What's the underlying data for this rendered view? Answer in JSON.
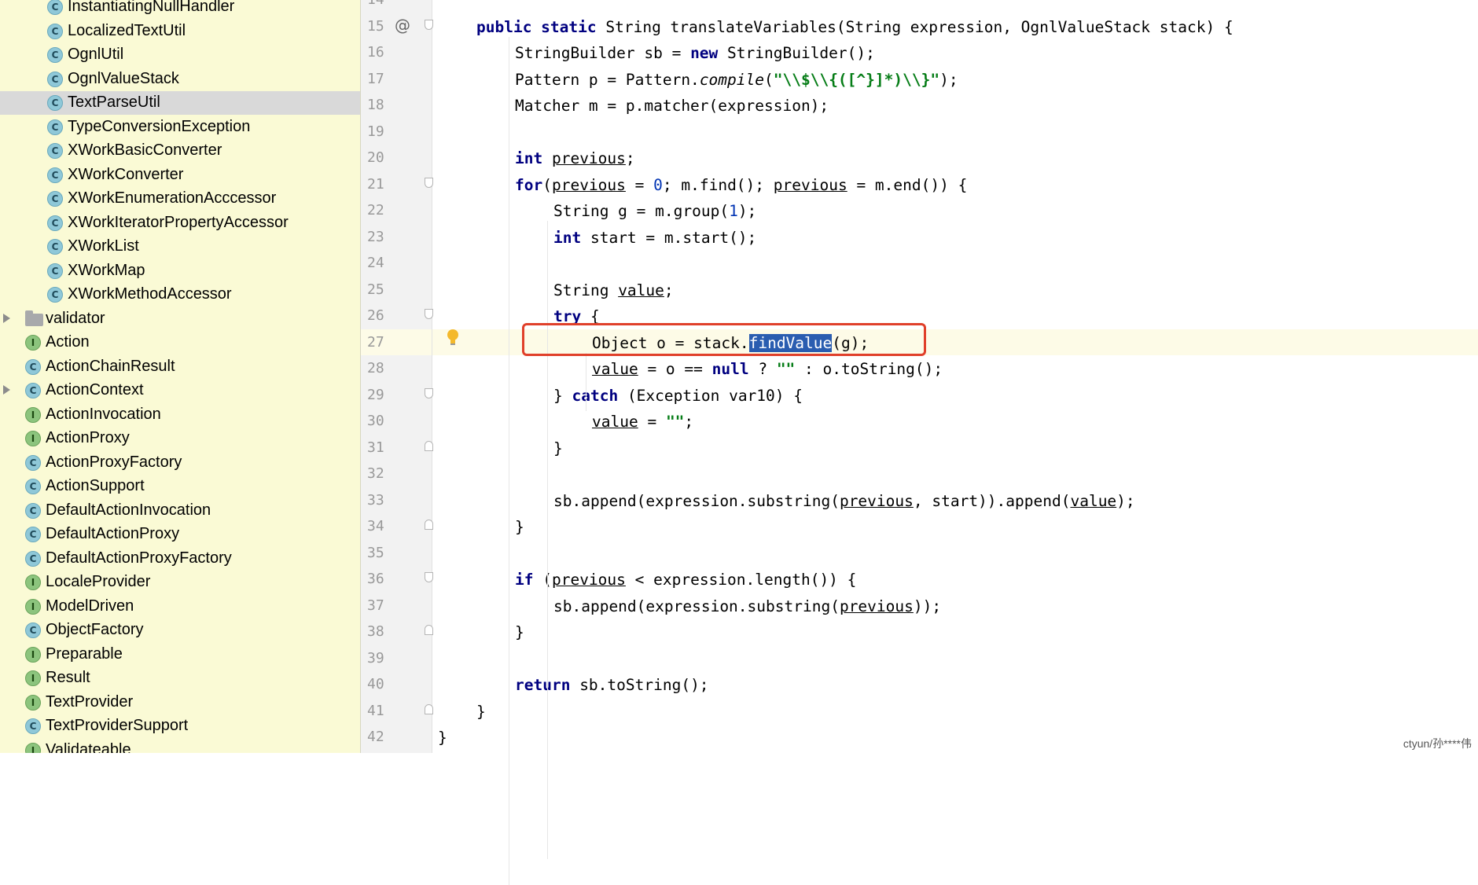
{
  "sidebar": {
    "items": [
      {
        "label": "InstantiatingNullHandler",
        "type": "class",
        "indent": 1,
        "selected": false,
        "expandable": false
      },
      {
        "label": "LocalizedTextUtil",
        "type": "class",
        "indent": 1,
        "selected": false,
        "expandable": false
      },
      {
        "label": "OgnlUtil",
        "type": "class",
        "indent": 1,
        "selected": false,
        "expandable": false
      },
      {
        "label": "OgnlValueStack",
        "type": "class",
        "indent": 1,
        "selected": false,
        "expandable": false
      },
      {
        "label": "TextParseUtil",
        "type": "class",
        "indent": 1,
        "selected": true,
        "expandable": false
      },
      {
        "label": "TypeConversionException",
        "type": "class",
        "indent": 1,
        "selected": false,
        "expandable": false
      },
      {
        "label": "XWorkBasicConverter",
        "type": "class",
        "indent": 1,
        "selected": false,
        "expandable": false
      },
      {
        "label": "XWorkConverter",
        "type": "class",
        "indent": 1,
        "selected": false,
        "expandable": false
      },
      {
        "label": "XWorkEnumerationAcccessor",
        "type": "class",
        "indent": 1,
        "selected": false,
        "expandable": false
      },
      {
        "label": "XWorkIteratorPropertyAccessor",
        "type": "class",
        "indent": 1,
        "selected": false,
        "expandable": false
      },
      {
        "label": "XWorkList",
        "type": "class",
        "indent": 1,
        "selected": false,
        "expandable": false
      },
      {
        "label": "XWorkMap",
        "type": "class",
        "indent": 1,
        "selected": false,
        "expandable": false
      },
      {
        "label": "XWorkMethodAccessor",
        "type": "class",
        "indent": 1,
        "selected": false,
        "expandable": false
      },
      {
        "label": "validator",
        "type": "folder",
        "indent": 0,
        "selected": false,
        "expandable": true
      },
      {
        "label": "Action",
        "type": "interface",
        "indent": 0,
        "selected": false,
        "expandable": false
      },
      {
        "label": "ActionChainResult",
        "type": "class",
        "indent": 0,
        "selected": false,
        "expandable": false
      },
      {
        "label": "ActionContext",
        "type": "class",
        "indent": 0,
        "selected": false,
        "expandable": true
      },
      {
        "label": "ActionInvocation",
        "type": "interface",
        "indent": 0,
        "selected": false,
        "expandable": false
      },
      {
        "label": "ActionProxy",
        "type": "interface",
        "indent": 0,
        "selected": false,
        "expandable": false
      },
      {
        "label": "ActionProxyFactory",
        "type": "class",
        "indent": 0,
        "selected": false,
        "expandable": false
      },
      {
        "label": "ActionSupport",
        "type": "class",
        "indent": 0,
        "selected": false,
        "expandable": false
      },
      {
        "label": "DefaultActionInvocation",
        "type": "class",
        "indent": 0,
        "selected": false,
        "expandable": false
      },
      {
        "label": "DefaultActionProxy",
        "type": "class",
        "indent": 0,
        "selected": false,
        "expandable": false
      },
      {
        "label": "DefaultActionProxyFactory",
        "type": "class",
        "indent": 0,
        "selected": false,
        "expandable": false
      },
      {
        "label": "LocaleProvider",
        "type": "interface",
        "indent": 0,
        "selected": false,
        "expandable": false
      },
      {
        "label": "ModelDriven",
        "type": "interface",
        "indent": 0,
        "selected": false,
        "expandable": false
      },
      {
        "label": "ObjectFactory",
        "type": "class",
        "indent": 0,
        "selected": false,
        "expandable": false
      },
      {
        "label": "Preparable",
        "type": "interface",
        "indent": 0,
        "selected": false,
        "expandable": false
      },
      {
        "label": "Result",
        "type": "interface",
        "indent": 0,
        "selected": false,
        "expandable": false
      },
      {
        "label": "TextProvider",
        "type": "interface",
        "indent": 0,
        "selected": false,
        "expandable": false
      },
      {
        "label": "TextProviderSupport",
        "type": "class",
        "indent": 0,
        "selected": false,
        "expandable": false
      },
      {
        "label": "Validateable",
        "type": "interface",
        "indent": 0,
        "selected": false,
        "expandable": false
      }
    ]
  },
  "editor": {
    "current_line": 27,
    "lines": [
      {
        "n": "14",
        "indent": 0,
        "tokens": []
      },
      {
        "n": "15",
        "indent": 1,
        "tokens": [
          [
            "kw",
            "public static "
          ],
          [
            "",
            "String translateVariables(String expression, OgnlValueStack stack) {"
          ]
        ]
      },
      {
        "n": "16",
        "indent": 2,
        "tokens": [
          [
            "",
            "StringBuilder sb = "
          ],
          [
            "kw",
            "new "
          ],
          [
            "",
            "StringBuilder();"
          ]
        ]
      },
      {
        "n": "17",
        "indent": 2,
        "tokens": [
          [
            "",
            "Pattern p = Pattern."
          ],
          [
            "method-i",
            "compile"
          ],
          [
            "",
            "("
          ],
          [
            "str",
            "\"\\\\$\\\\{([^}]*)\\\\}\""
          ],
          [
            "",
            ");"
          ]
        ]
      },
      {
        "n": "18",
        "indent": 2,
        "tokens": [
          [
            "",
            "Matcher m = p.matcher(expression);"
          ]
        ]
      },
      {
        "n": "19",
        "indent": 0,
        "tokens": []
      },
      {
        "n": "20",
        "indent": 2,
        "tokens": [
          [
            "kw",
            "int "
          ],
          [
            "var",
            "previous"
          ],
          [
            "",
            ";"
          ]
        ]
      },
      {
        "n": "21",
        "indent": 2,
        "tokens": [
          [
            "kw",
            "for"
          ],
          [
            "",
            "("
          ],
          [
            "var",
            "previous"
          ],
          [
            "",
            " = "
          ],
          [
            "num-lit",
            "0"
          ],
          [
            "",
            "; m.find(); "
          ],
          [
            "var",
            "previous"
          ],
          [
            "",
            " = m.end()) {"
          ]
        ]
      },
      {
        "n": "22",
        "indent": 3,
        "tokens": [
          [
            "",
            "String g = m.group("
          ],
          [
            "num-lit",
            "1"
          ],
          [
            "",
            ");"
          ]
        ]
      },
      {
        "n": "23",
        "indent": 3,
        "tokens": [
          [
            "kw",
            "int "
          ],
          [
            "",
            "start = m.start();"
          ]
        ]
      },
      {
        "n": "24",
        "indent": 0,
        "tokens": []
      },
      {
        "n": "25",
        "indent": 3,
        "tokens": [
          [
            "",
            "String "
          ],
          [
            "var",
            "value"
          ],
          [
            "",
            ";"
          ]
        ]
      },
      {
        "n": "26",
        "indent": 3,
        "tokens": [
          [
            "kw",
            "try "
          ],
          [
            "",
            "{"
          ]
        ]
      },
      {
        "n": "27",
        "indent": 4,
        "tokens": [
          [
            "",
            "Object o = stack."
          ],
          [
            "sel",
            "findValue"
          ],
          [
            "",
            "(g);"
          ]
        ]
      },
      {
        "n": "28",
        "indent": 4,
        "tokens": [
          [
            "var",
            "value"
          ],
          [
            "",
            " = o == "
          ],
          [
            "kw",
            "null "
          ],
          [
            "",
            "? "
          ],
          [
            "str",
            "\"\""
          ],
          [
            "",
            " : o.toString();"
          ]
        ]
      },
      {
        "n": "29",
        "indent": 3,
        "tokens": [
          [
            "",
            "} "
          ],
          [
            "kw",
            "catch "
          ],
          [
            "",
            "(Exception var10) {"
          ]
        ]
      },
      {
        "n": "30",
        "indent": 4,
        "tokens": [
          [
            "var",
            "value"
          ],
          [
            "",
            " = "
          ],
          [
            "str",
            "\"\""
          ],
          [
            "",
            ";"
          ]
        ]
      },
      {
        "n": "31",
        "indent": 3,
        "tokens": [
          [
            "",
            "}"
          ]
        ]
      },
      {
        "n": "32",
        "indent": 0,
        "tokens": []
      },
      {
        "n": "33",
        "indent": 3,
        "tokens": [
          [
            "",
            "sb.append(expression.substring("
          ],
          [
            "var",
            "previous"
          ],
          [
            "",
            ", start)).append("
          ],
          [
            "var",
            "value"
          ],
          [
            "",
            ");"
          ]
        ]
      },
      {
        "n": "34",
        "indent": 2,
        "tokens": [
          [
            "",
            "}"
          ]
        ]
      },
      {
        "n": "35",
        "indent": 0,
        "tokens": []
      },
      {
        "n": "36",
        "indent": 2,
        "tokens": [
          [
            "kw",
            "if "
          ],
          [
            "",
            "("
          ],
          [
            "var",
            "previous"
          ],
          [
            "",
            " < expression.length()) {"
          ]
        ]
      },
      {
        "n": "37",
        "indent": 3,
        "tokens": [
          [
            "",
            "sb.append(expression.substring("
          ],
          [
            "var",
            "previous"
          ],
          [
            "",
            "));"
          ]
        ]
      },
      {
        "n": "38",
        "indent": 2,
        "tokens": [
          [
            "",
            "}"
          ]
        ]
      },
      {
        "n": "39",
        "indent": 0,
        "tokens": []
      },
      {
        "n": "40",
        "indent": 2,
        "tokens": [
          [
            "kw",
            "return "
          ],
          [
            "",
            "sb.toString();"
          ]
        ]
      },
      {
        "n": "41",
        "indent": 1,
        "tokens": [
          [
            "",
            "}"
          ]
        ]
      },
      {
        "n": "42",
        "indent": 0,
        "tokens": [
          [
            "",
            "}"
          ]
        ]
      }
    ],
    "gutter_marks": {
      "15": "override",
      "21": "fold-open",
      "26": "fold-open",
      "29": "fold-open",
      "31": "fold-close",
      "34": "fold-close",
      "36": "fold-open",
      "38": "fold-close",
      "41": "fold-close"
    }
  },
  "watermark": "ctyun/孙****伟",
  "colors": {
    "keyword": "#000080",
    "string": "#067d17",
    "number": "#0033b3",
    "selection": "#2a5db0",
    "callout": "#e0402a",
    "sidebar_bg": "#fafad5",
    "current_line_bg": "#fdfbe7"
  },
  "icons": {
    "class": "class-icon",
    "interface": "interface-icon",
    "folder": "folder-icon",
    "override": "override-at-icon",
    "intention": "lightbulb-icon"
  }
}
